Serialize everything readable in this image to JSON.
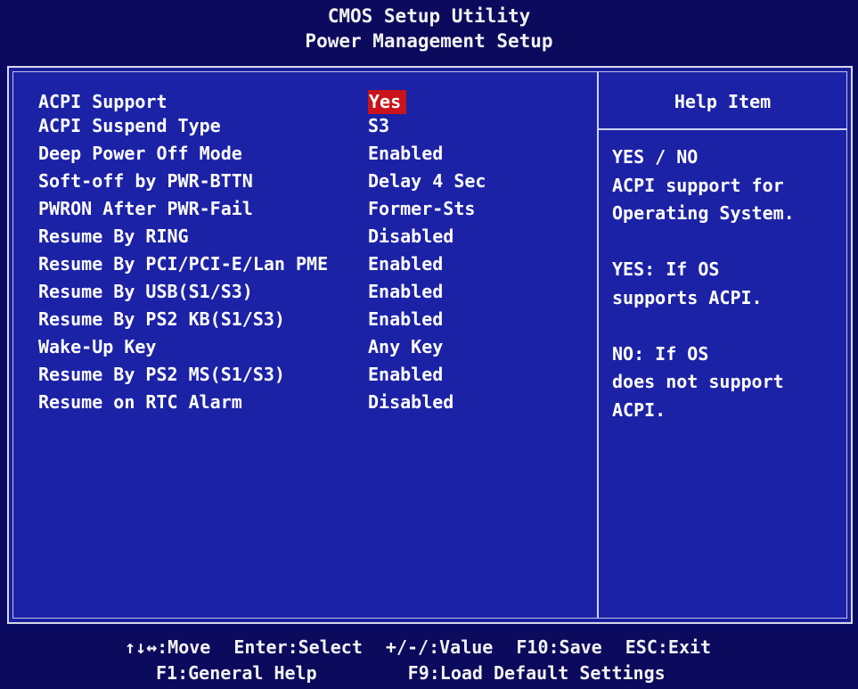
{
  "header": {
    "title": "CMOS Setup Utility",
    "subtitle": "Power Management Setup"
  },
  "settings": [
    {
      "label": "ACPI Support",
      "value": "Yes",
      "selected": true
    },
    {
      "label": "ACPI Suspend Type",
      "value": "S3"
    },
    {
      "label": "Deep Power Off Mode",
      "value": "Enabled"
    },
    {
      "label": "Soft-off by PWR-BTTN",
      "value": "Delay 4 Sec"
    },
    {
      "label": "PWRON After PWR-Fail",
      "value": "Former-Sts"
    },
    {
      "label": "Resume By RING",
      "value": "Disabled"
    },
    {
      "label": "Resume By PCI/PCI-E/Lan PME",
      "value": "Enabled"
    },
    {
      "label": "Resume By USB(S1/S3)",
      "value": "Enabled"
    },
    {
      "label": "Resume By PS2 KB(S1/S3)",
      "value": "Enabled"
    },
    {
      "label": "Wake-Up Key",
      "value": "Any Key"
    },
    {
      "label": "Resume By PS2 MS(S1/S3)",
      "value": "Enabled"
    },
    {
      "label": "Resume on RTC Alarm",
      "value": "Disabled"
    }
  ],
  "help": {
    "title": "Help Item",
    "lines": [
      "YES / NO",
      "ACPI support for",
      "Operating System.",
      "",
      "YES: If OS",
      "supports ACPI.",
      "",
      "NO: If OS",
      "does not support",
      "ACPI."
    ]
  },
  "footer": {
    "line1": {
      "move": "↑↓↔:Move",
      "enter": "Enter:Select",
      "value": "+/-/:Value",
      "save": "F10:Save",
      "exit": "ESC:Exit"
    },
    "line2": {
      "help": "F1:General Help",
      "defaults": "F9:Load Default Settings"
    }
  },
  "colors": {
    "background": "#1c22a6",
    "header_bg": "#0b0a5c",
    "selection": "#c8141a",
    "text": "#ffffff"
  }
}
